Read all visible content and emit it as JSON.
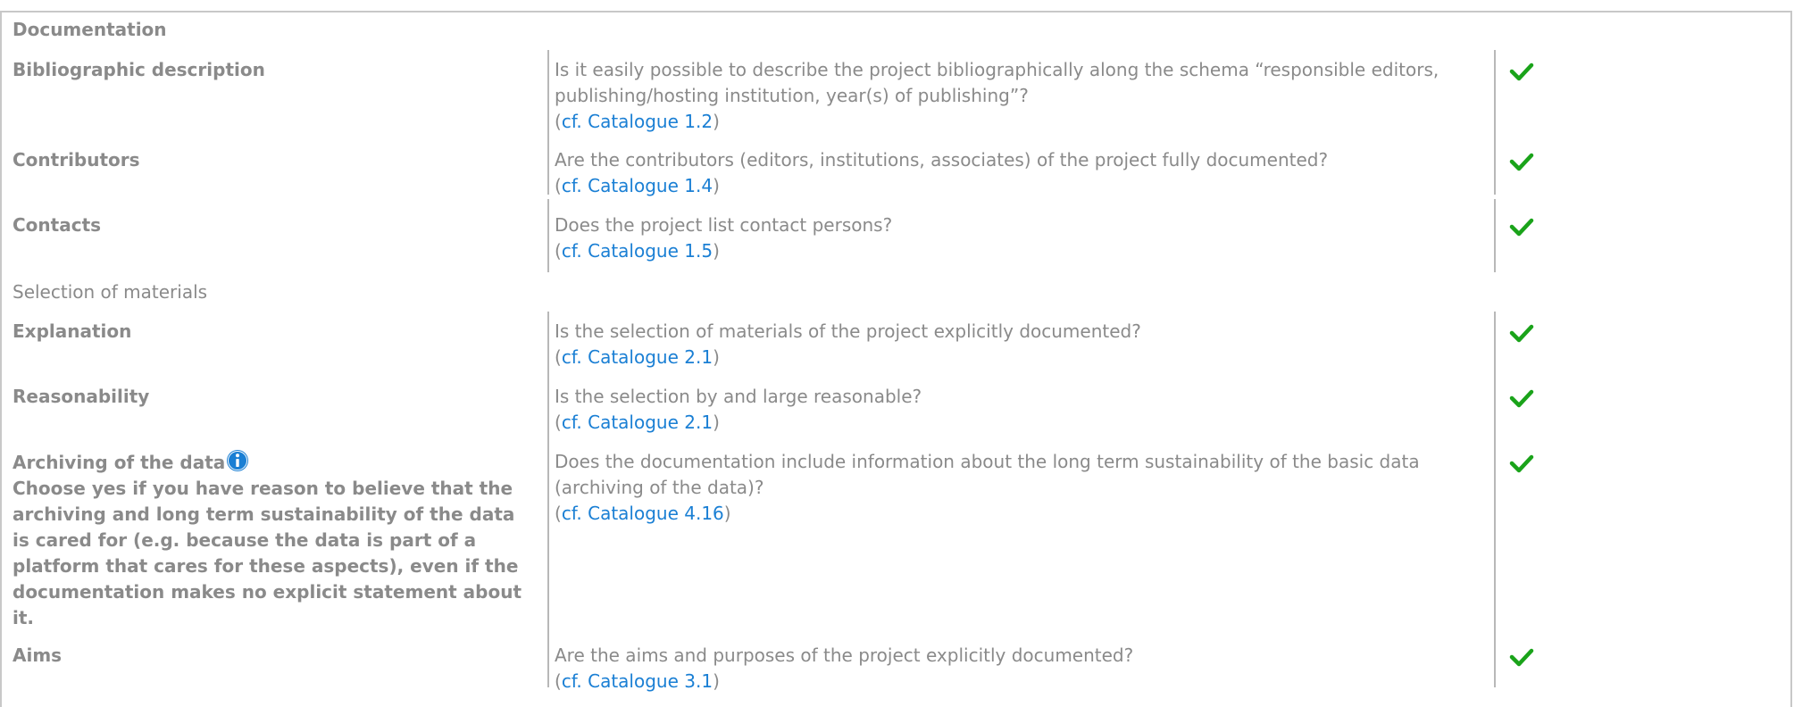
{
  "sections": {
    "documentation": "Documentation",
    "selection": "Selection of materials"
  },
  "rows": [
    {
      "label": "Bibliographic description",
      "question": "Is it easily possible to describe the project bibliographically along the schema “responsible editors, publishing/hosting institution, year(s) of publishing”?",
      "ref": "cf. Catalogue 1.2",
      "answer": "check-icon"
    },
    {
      "label": "Contributors",
      "question": "Are the contributors (editors, institutions, associates) of the project fully documented?",
      "ref": "cf. Catalogue 1.4",
      "answer": "check-icon"
    },
    {
      "label": "Contacts",
      "question": "Does the project list contact persons?",
      "ref": "cf. Catalogue 1.5",
      "answer": "check-icon"
    },
    {
      "label": "Explanation",
      "question": "Is the selection of materials of the project explicitly documented?",
      "ref": "cf. Catalogue 2.1",
      "answer": "check-icon"
    },
    {
      "label": "Reasonability",
      "question": "Is the selection by and large reasonable?",
      "ref": "cf. Catalogue 2.1",
      "answer": "check-icon"
    },
    {
      "label": "Archiving of the data",
      "hint": "Choose yes if you have reason to believe that the archiving and long term sustainability of the data is cared for (e.g. because the data is part of a platform that cares for these aspects), even if the documentation makes no explicit statement about it.",
      "question": "Does the documentation include information about the long term sustainability of the basic data (archiving of the data)?",
      "ref": "cf. Catalogue 4.16",
      "answer": "check-icon",
      "icon": "info-icon"
    },
    {
      "label": "Aims",
      "question": "Are the aims and purposes of the project explicitly documented?",
      "ref": "cf. Catalogue 3.1",
      "answer": "check-icon"
    }
  ],
  "colors": {
    "text": "#8a8a8a",
    "link": "#1a7fd4",
    "check": "#1aa31a",
    "info": "#1a7fd4"
  },
  "paren_open": "(",
  "paren_close": ")"
}
